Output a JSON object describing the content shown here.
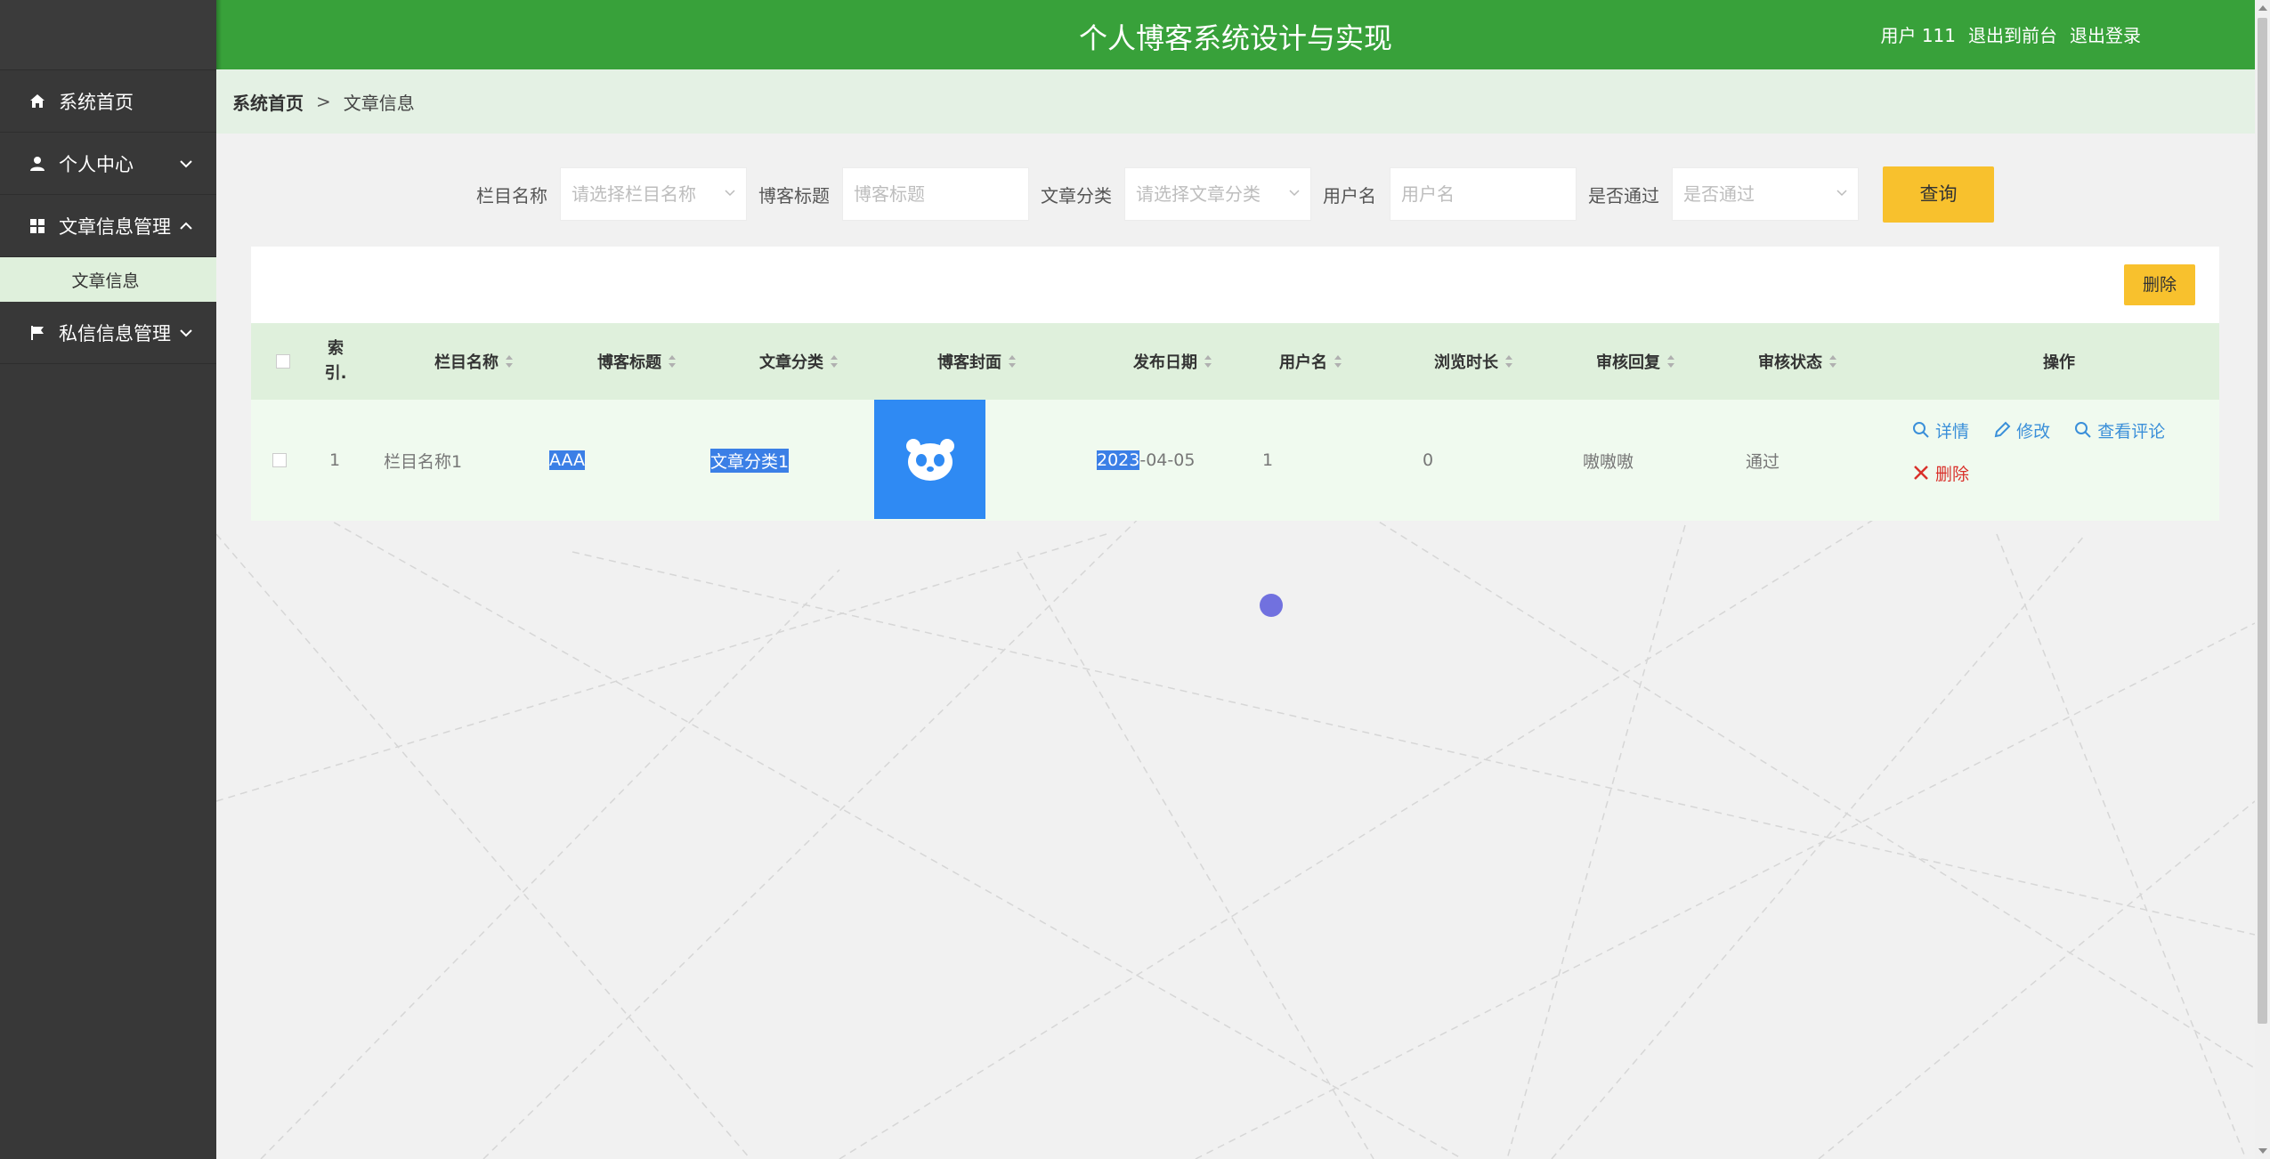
{
  "header": {
    "title": "个人博客系统设计与实现",
    "user": "用户 111",
    "to_front": "退出到前台",
    "logout": "退出登录"
  },
  "sidebar": {
    "items": [
      {
        "label": "系统首页",
        "icon": "home-icon"
      },
      {
        "label": "个人中心",
        "icon": "user-icon",
        "expanded": false
      },
      {
        "label": "文章信息管理",
        "icon": "grid-icon",
        "expanded": true
      },
      {
        "label": "私信信息管理",
        "icon": "flag-icon",
        "expanded": false
      }
    ],
    "sub_item": "文章信息"
  },
  "breadcrumb": {
    "home": "系统首页",
    "separator": ">",
    "current": "文章信息"
  },
  "search": {
    "column_label": "栏目名称",
    "column_placeholder": "请选择栏目名称",
    "title_label": "博客标题",
    "title_placeholder": "博客标题",
    "category_label": "文章分类",
    "category_placeholder": "请选择文章分类",
    "username_label": "用户名",
    "username_placeholder": "用户名",
    "passed_label": "是否通过",
    "passed_placeholder": "是否通过",
    "query_button": "查询"
  },
  "toolbar": {
    "delete_button": "删除"
  },
  "table": {
    "headers": {
      "index": "索引.",
      "column": "栏目名称",
      "title": "博客标题",
      "category": "文章分类",
      "cover": "博客封面",
      "date": "发布日期",
      "username": "用户名",
      "duration": "浏览时长",
      "reply": "审核回复",
      "status": "审核状态",
      "actions": "操作"
    },
    "rows": [
      {
        "index": "1",
        "column": "栏目名称1",
        "title": "AAA",
        "category": "文章分类1",
        "date_selected": "2023",
        "date_rest": "-04-05",
        "username": "1",
        "duration": "0",
        "reply": "嗷嗷嗷",
        "status": "通过"
      }
    ],
    "actions": {
      "detail": "详情",
      "edit": "修改",
      "comments": "查看评论",
      "delete": "删除"
    }
  },
  "colors": {
    "header_green": "#38a13a",
    "sidebar_dark": "#383838",
    "button_yellow": "#f8c12d",
    "link_blue": "#3a8fd9",
    "delete_red": "#d9302a"
  }
}
